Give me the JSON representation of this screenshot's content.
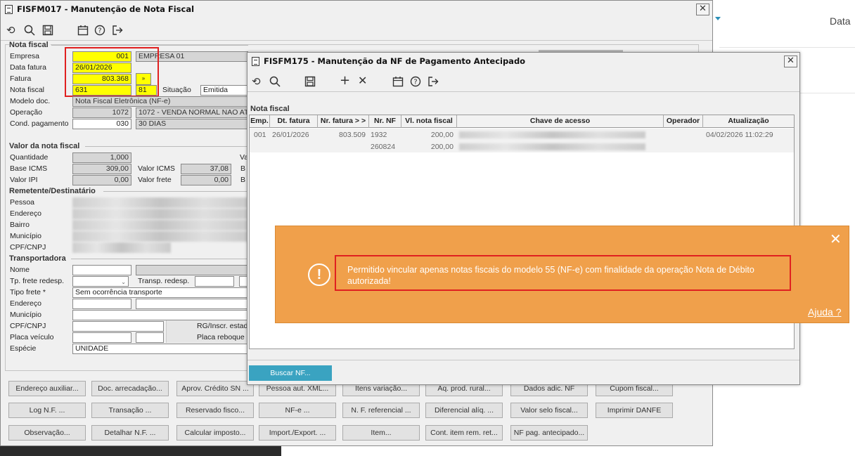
{
  "right_header": {
    "label": "Data"
  },
  "main_window": {
    "title": "FISFM017 - Manutenção de Nota Fiscal",
    "toolbar": [
      "undo-icon",
      "search-icon",
      "save-icon",
      "calendar-icon",
      "help-icon",
      "exit-icon"
    ],
    "sections": {
      "nota_fiscal": "Nota fiscal",
      "valor": "Valor da nota fiscal",
      "remetente": "Remetente/Destinatário",
      "transportadora": "Transportadora"
    },
    "fields": {
      "empresa_label": "Empresa",
      "empresa_code": "001",
      "empresa_name": "EMPRESA 01",
      "data_fatura_label": "Data fatura",
      "data_fatura": "26/01/2026",
      "fatura_label": "Fatura",
      "fatura": "803.368",
      "nota_fiscal_label": "Nota fiscal",
      "nota_fiscal": "631",
      "serie": "81",
      "situacao_label": "Situação",
      "situacao": "Emitida",
      "modelo_label": "Modelo doc.",
      "modelo": "Nota Fiscal Eletrônica (NF-e)",
      "operacao_label": "Operação",
      "operacao_code": "1072",
      "operacao_name": "1072 - VENDA NORMAL NAO AT",
      "cond_label": "Cond. pagamento",
      "cond_code": "030",
      "cond_name": "30 DIAS",
      "quantidade_label": "Quantidade",
      "quantidade": "1,000",
      "base_icms_label": "Base ICMS",
      "base_icms": "309,00",
      "valor_icms_label": "Valor ICMS",
      "valor_icms": "37,08",
      "valor_ipi_label": "Valor IPI",
      "valor_ipi": "0,00",
      "valor_frete_label": "Valor frete",
      "valor_frete": "0,00",
      "cut_va": "Va",
      "cut_b1": "B",
      "cut_b2": "B",
      "pessoa_label": "Pessoa",
      "endereco_label": "Endereço",
      "bairro_label": "Bairro",
      "municipio_label": "Município",
      "cpf_label": "CPF/CNPJ",
      "nome_label": "Nome",
      "tp_frete_label": "Tp. frete redesp.",
      "transp_redesp_label": "Transp. redesp.",
      "tipo_frete_label": "Tipo frete *",
      "tipo_frete": "Sem ocorrência transporte",
      "t_endereco_label": "Endereço",
      "t_municipio_label": "Município",
      "t_cpf_label": "CPF/CNPJ",
      "rg_label": "RG/Inscr. estad",
      "placa_label": "Placa veículo",
      "placa_reboque_label": "Placa reboque",
      "especie_label": "Espécie",
      "especie": "UNIDADE"
    },
    "buttons_row1": [
      "Endereço auxiliar...",
      "Doc. arrecadação...",
      "Aprov. Crédito SN ...",
      "Pessoa aut. XML...",
      "Itens variação...",
      "Aq. prod. rural...",
      "Dados adic. NF",
      "Cupom fiscal..."
    ],
    "buttons_row2": [
      "Log N.F. ...",
      "Transação ...",
      "Reservado fisco...",
      "NF-e ...",
      "N. F. referencial ...",
      "Diferencial alíq. ...",
      "Valor selo fiscal...",
      "Imprimir DANFE"
    ],
    "buttons_row3": [
      "Observação...",
      "Detalhar N.F. ...",
      "Calcular imposto...",
      "Import./Export. ...",
      "Item...",
      "Cont. item rem. ret...",
      "NF pag. antecipado..."
    ]
  },
  "sub_window": {
    "title": "FISFM175 - Manutenção da NF de Pagamento Antecipado",
    "toolbar": [
      "undo-icon",
      "search-icon",
      "save-icon",
      "plus-icon",
      "close-icon",
      "calendar-icon",
      "help-icon",
      "exit-icon"
    ],
    "section": "Nota fiscal",
    "columns": [
      "Emp.",
      "Dt. fatura",
      "Nr. fatura > >",
      "Nr. NF",
      "Vl. nota fiscal",
      "Chave de acesso",
      "Operador",
      "Atualização"
    ],
    "rows": [
      {
        "emp": "001",
        "dt": "26/01/2026",
        "nr_fatura": "803.509",
        "nr_nf": "1932",
        "valor": "200,00",
        "operador": "",
        "atualizacao": "04/02/2026 11:02:29"
      },
      {
        "emp": "",
        "dt": "",
        "nr_fatura": "",
        "nr_nf": "260824",
        "valor": "200,00",
        "operador": "",
        "atualizacao": ""
      }
    ],
    "buscar_button": "Buscar NF..."
  },
  "alert": {
    "message": "Permitido vincular apenas notas fiscais do modelo 55 (NF-e) com finalidade da operação Nota de Débito autorizada!",
    "help_link": "Ajuda ?",
    "colors": {
      "background": "#f0a04b",
      "highlight": "#e02020"
    }
  }
}
